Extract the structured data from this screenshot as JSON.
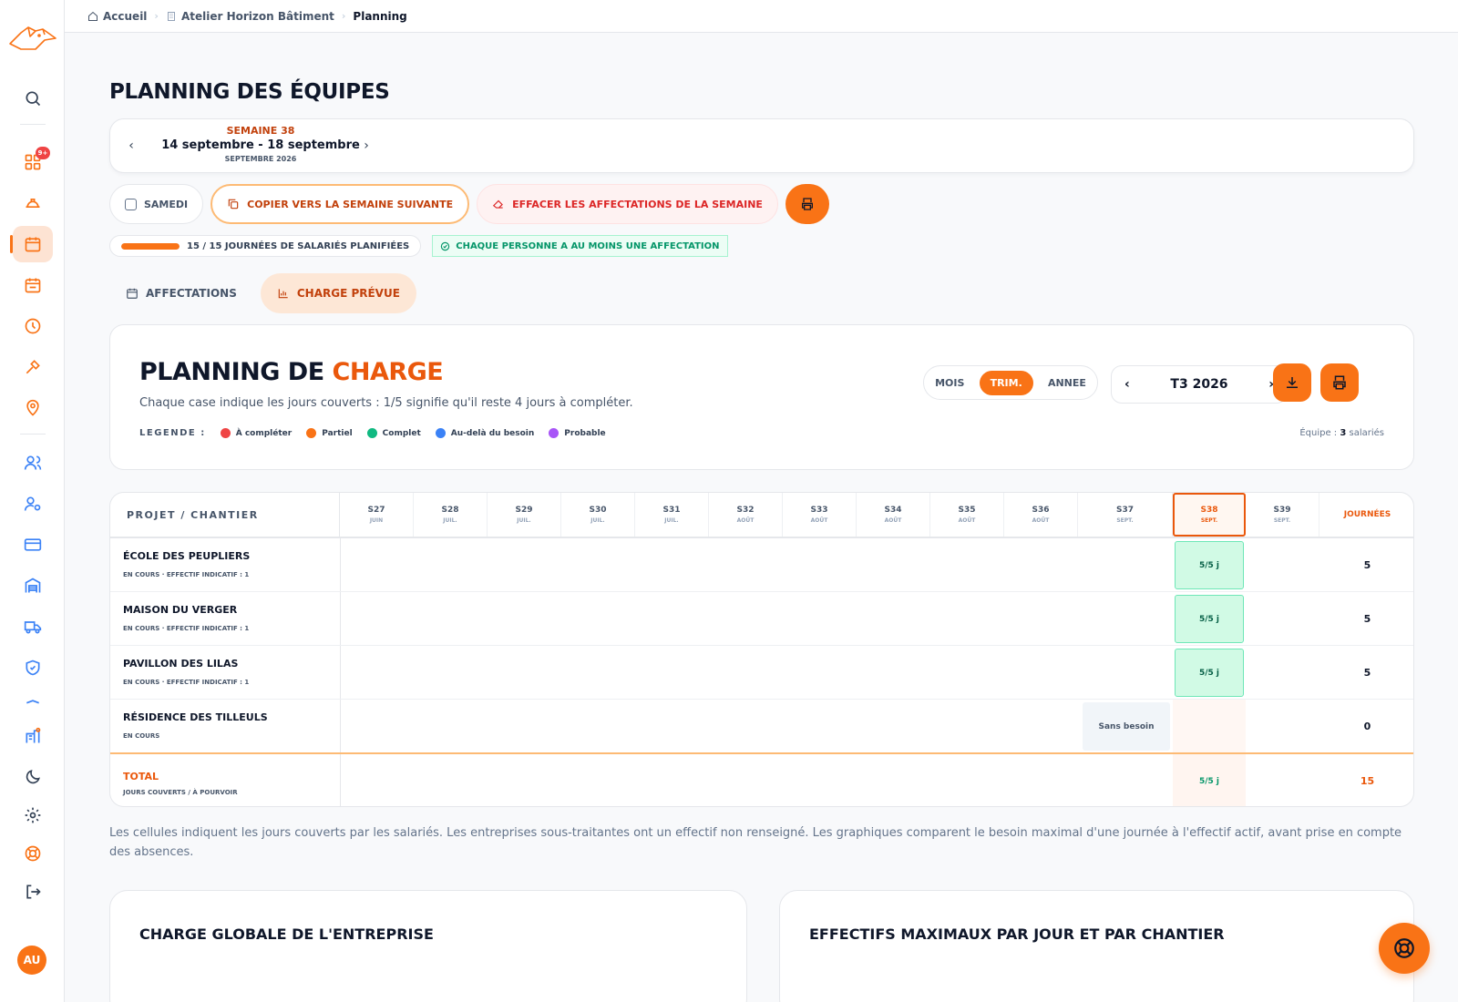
{
  "app": {
    "avatar_initials": "AU",
    "notification_count": "9+"
  },
  "breadcrumb": [
    {
      "label": "Accueil",
      "icon": "home-icon"
    },
    {
      "label": "Atelier Horizon Bâtiment",
      "icon": "building-icon"
    },
    {
      "label": "Planning"
    }
  ],
  "page": {
    "title": "PLANNING DES ÉQUIPES"
  },
  "week": {
    "number": "SEMAINE 38",
    "range": "14 septembre - 18 septembre",
    "month": "SEPTEMBRE 2026"
  },
  "actions": {
    "saturday": "SAMEDI",
    "copy": "COPIER VERS LA SEMAINE SUIVANTE",
    "erase": "EFFACER LES AFFECTATIONS DE LA SEMAINE"
  },
  "status": {
    "progress_label": "15 / 15 JOURNÉES DE SALARIÉS PLANIFIÉES",
    "progress_done": 15,
    "progress_total": 15,
    "ok_label": "CHAQUE PERSONNE A AU MOINS UNE AFFECTATION"
  },
  "tabs": [
    {
      "label": "AFFECTATIONS",
      "active": false
    },
    {
      "label": "CHARGE PRÉVUE",
      "active": true
    }
  ],
  "charge": {
    "title_main": "PLANNING DE ",
    "title_highlight": "CHARGE",
    "subtitle": "Chaque case indique les jours couverts : 1/5 signifie qu'il reste 4 jours à compléter.",
    "legend_title": "LEGENDE :",
    "legend": [
      {
        "label": "À compléter",
        "color": "#ef4444"
      },
      {
        "label": "Partiel",
        "color": "#f97316"
      },
      {
        "label": "Complet",
        "color": "#10b981"
      },
      {
        "label": "Au-delà du besoin",
        "color": "#3b82f6"
      },
      {
        "label": "Probable",
        "color": "#a855f7"
      }
    ],
    "view_modes": [
      "MOIS",
      "TRIM.",
      "ANNEE"
    ],
    "active_mode": "TRIM.",
    "period": "T3 2026",
    "team_prefix": "Équipe : ",
    "team_count": "3",
    "team_suffix": " salariés"
  },
  "grid": {
    "project_header": "PROJET / CHANTIER",
    "total_header": "JOURNÉES",
    "weeks": [
      {
        "w": "S27",
        "m": "JUIN"
      },
      {
        "w": "S28",
        "m": "JUIL."
      },
      {
        "w": "S29",
        "m": "JUIL."
      },
      {
        "w": "S30",
        "m": "JUIL."
      },
      {
        "w": "S31",
        "m": "JUIL."
      },
      {
        "w": "S32",
        "m": "AOÛT"
      },
      {
        "w": "S33",
        "m": "AOÛT"
      },
      {
        "w": "S34",
        "m": "AOÛT"
      },
      {
        "w": "S35",
        "m": "AOÛT"
      },
      {
        "w": "S36",
        "m": "AOÛT"
      },
      {
        "w": "S37",
        "m": "SEPT."
      },
      {
        "w": "S38",
        "m": "SEPT."
      },
      {
        "w": "S39",
        "m": "SEPT."
      }
    ],
    "rows": [
      {
        "name": "ÉCOLE DES PEUPLIERS",
        "meta": "EN COURS · EFFECTIF INDICATIF : 1",
        "cell": "5/5 j",
        "total": "5"
      },
      {
        "name": "MAISON DU VERGER",
        "meta": "EN COURS · EFFECTIF INDICATIF : 1",
        "cell": "5/5 j",
        "total": "5"
      },
      {
        "name": "PAVILLON DES LILAS",
        "meta": "EN COURS · EFFECTIF INDICATIF : 1",
        "cell": "5/5 j",
        "total": "5"
      },
      {
        "name": "RÉSIDENCE DES TILLEULS",
        "meta": "EN COURS",
        "cell": "Sans besoin",
        "total": "0"
      }
    ],
    "total": {
      "name": "TOTAL",
      "meta": "JOURS COUVERTS / À POURVOIR",
      "cell": "5/5 j",
      "sum": "15"
    }
  },
  "note": "Les cellules indiquent les jours couverts par les salariés. Les entreprises sous-traitantes ont un effectif non renseigné. Les graphiques comparent le besoin maximal d'une journée à l'effectif actif, avant prise en compte des absences.",
  "cards": {
    "global": "CHARGE GLOBALE DE L'ENTREPRISE",
    "max": "EFFECTIFS MAXIMAUX PAR JOUR ET PAR CHANTIER"
  },
  "colors": {
    "accent": "#f97316",
    "accent_dark": "#ea580c",
    "complete": "#10b981"
  }
}
